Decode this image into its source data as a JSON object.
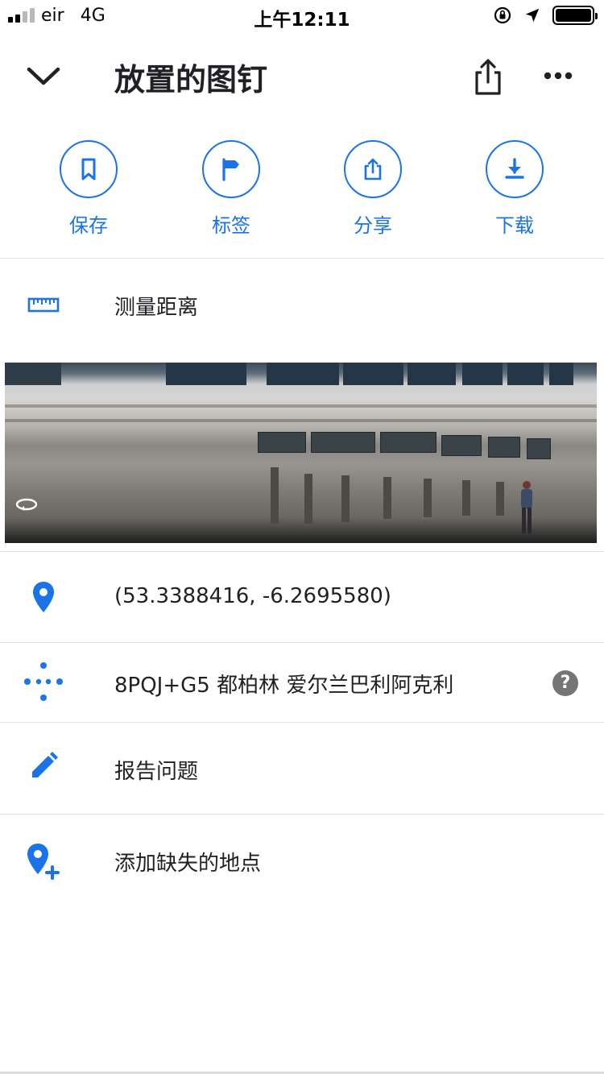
{
  "status_bar": {
    "carrier": "eir",
    "network": "4G",
    "time": "上午12:11",
    "signal_bars_filled": 2,
    "signal_bars_total": 4
  },
  "header": {
    "title": "放置的图钉",
    "back_icon": "chevron-down-icon",
    "share_icon": "share-icon",
    "more_icon": "more-horizontal-icon"
  },
  "actions": [
    {
      "label": "保存",
      "icon": "bookmark-icon"
    },
    {
      "label": "标签",
      "icon": "flag-icon"
    },
    {
      "label": "分享",
      "icon": "share-icon"
    },
    {
      "label": "下载",
      "icon": "download-icon"
    }
  ],
  "measure": {
    "label": "测量距离",
    "icon": "ruler-icon"
  },
  "details": {
    "coordinates": "(53.3388416, -6.2695580)",
    "plus_code": "8PQJ+G5 都柏林 爱尔兰巴利阿克利",
    "help_symbol": "?"
  },
  "report": {
    "label": "报告问题",
    "icon": "pencil-icon"
  },
  "add_place": {
    "label": "添加缺失的地点",
    "icon": "add-location-icon"
  },
  "colors": {
    "accent": "#1a73e8",
    "text": "#202124",
    "divider": "#e0e0e0"
  }
}
